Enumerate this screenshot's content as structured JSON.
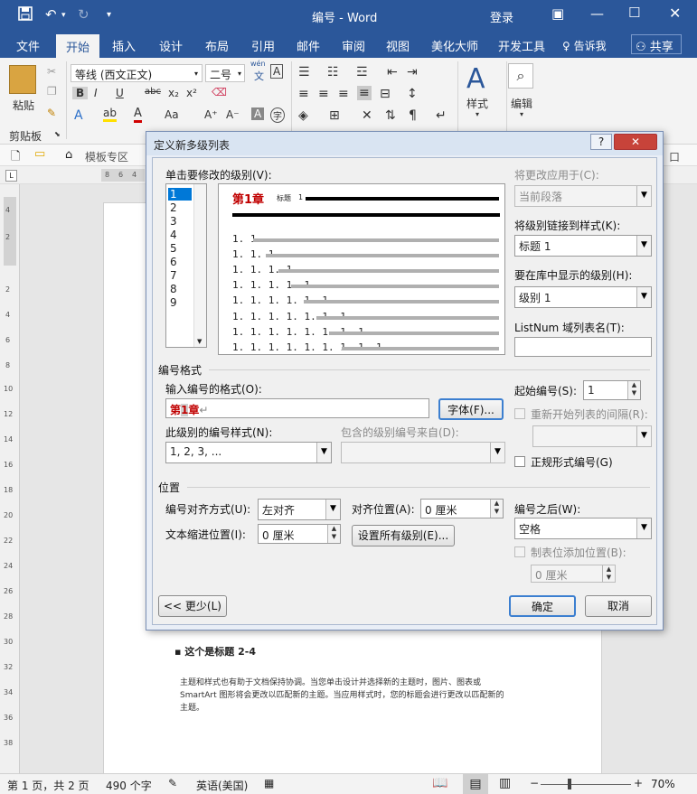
{
  "app": {
    "doc_title": "编号",
    "app_name": "Word",
    "separator": " - ",
    "login": "登录"
  },
  "tabs": [
    "文件",
    "开始",
    "插入",
    "设计",
    "布局",
    "引用",
    "邮件",
    "审阅",
    "视图",
    "美化大师",
    "开发工具"
  ],
  "tellme": "告诉我",
  "share": "共享",
  "ribbon": {
    "paste": "粘贴",
    "clipboard": "剪贴板",
    "font_name": "等线 (西文正文)",
    "font_size": "二号",
    "wen_label": "wén",
    "wen_char": "文",
    "styles": "样式",
    "editing": "编辑",
    "bold": "B",
    "italic": "I",
    "underline": "U",
    "strike": "abc",
    "sub": "x₂",
    "sup": "x²"
  },
  "quickbar": {
    "template": "模板专区",
    "right": "口"
  },
  "ruler_marks": [
    "8",
    "6",
    "4"
  ],
  "vruler_marks": [
    "4",
    "2",
    "2",
    "4",
    "6",
    "8",
    "10",
    "12",
    "14",
    "16",
    "18",
    "20",
    "22",
    "24",
    "26",
    "28",
    "30",
    "32",
    "34",
    "36",
    "38"
  ],
  "document": {
    "heading": "这个是标题 2-4",
    "paragraph1": "主题和样式也有助于文档保持协调。当您单击设计并选择新的主题时，图片、图表或",
    "paragraph2": "SmartArt 图形将会更改以匹配新的主题。当应用样式时，您的标题会进行更改以匹配新的",
    "paragraph3": "主题。"
  },
  "dialog": {
    "title": "定义新多级列表",
    "help": "?",
    "close": "✕",
    "level_label": "单击要修改的级别(V):",
    "levels": [
      "1",
      "2",
      "3",
      "4",
      "5",
      "6",
      "7",
      "8",
      "9"
    ],
    "selected_level": "1",
    "preview": {
      "chapter": "第1章",
      "heading_small": "标题",
      "heading_num": "1",
      "rows": [
        "1. 1",
        "1. 1. 1",
        "1. 1. 1. 1",
        "1. 1. 1. 1. 1",
        "1. 1. 1. 1. 1. 1",
        "1. 1. 1. 1. 1. 1. 1",
        "1. 1. 1. 1. 1. 1. 1. 1",
        "1. 1. 1. 1. 1. 1. 1. 1. 1"
      ]
    },
    "apply_to_label": "将更改应用于(C):",
    "apply_to_value": "当前段落",
    "link_style_label": "将级别链接到样式(K):",
    "link_style_value": "标题 1",
    "gallery_level_label": "要在库中显示的级别(H):",
    "gallery_level_value": "级别 1",
    "listnum_label": "ListNum 域列表名(T):",
    "listnum_value": "",
    "number_format_group": "编号格式",
    "enter_format_label": "输入编号的格式(O):",
    "format_prefix": "第",
    "format_num": "1",
    "format_suffix": "章",
    "font_button": "字体(F)...",
    "start_at_label": "起始编号(S):",
    "start_at_value": "1",
    "restart_label": "重新开始列表的间隔(R):",
    "style_label": "此级别的编号样式(N):",
    "style_value": "1, 2, 3, ...",
    "include_label": "包含的级别编号来自(D):",
    "legal_label": "正规形式编号(G)",
    "position_group": "位置",
    "align_label": "编号对齐方式(U):",
    "align_value": "左对齐",
    "align_at_label": "对齐位置(A):",
    "align_at_value": "0 厘米",
    "indent_label": "文本缩进位置(I):",
    "indent_value": "0 厘米",
    "set_all_button": "设置所有级别(E)...",
    "follow_label": "编号之后(W):",
    "follow_value": "空格",
    "tabstop_label": "制表位添加位置(B):",
    "tabstop_value": "0 厘米",
    "less_button": "<< 更少(L)",
    "ok_button": "确定",
    "cancel_button": "取消"
  },
  "status": {
    "page": "第 1 页，共 2 页",
    "words": "490 个字",
    "lang": "英语(美国)",
    "zoom": "70%",
    "zoom_minus": "−",
    "zoom_plus": "+"
  },
  "colors": {
    "accent": "#2b579a",
    "red": "#c00000",
    "select": "#0078d7"
  }
}
